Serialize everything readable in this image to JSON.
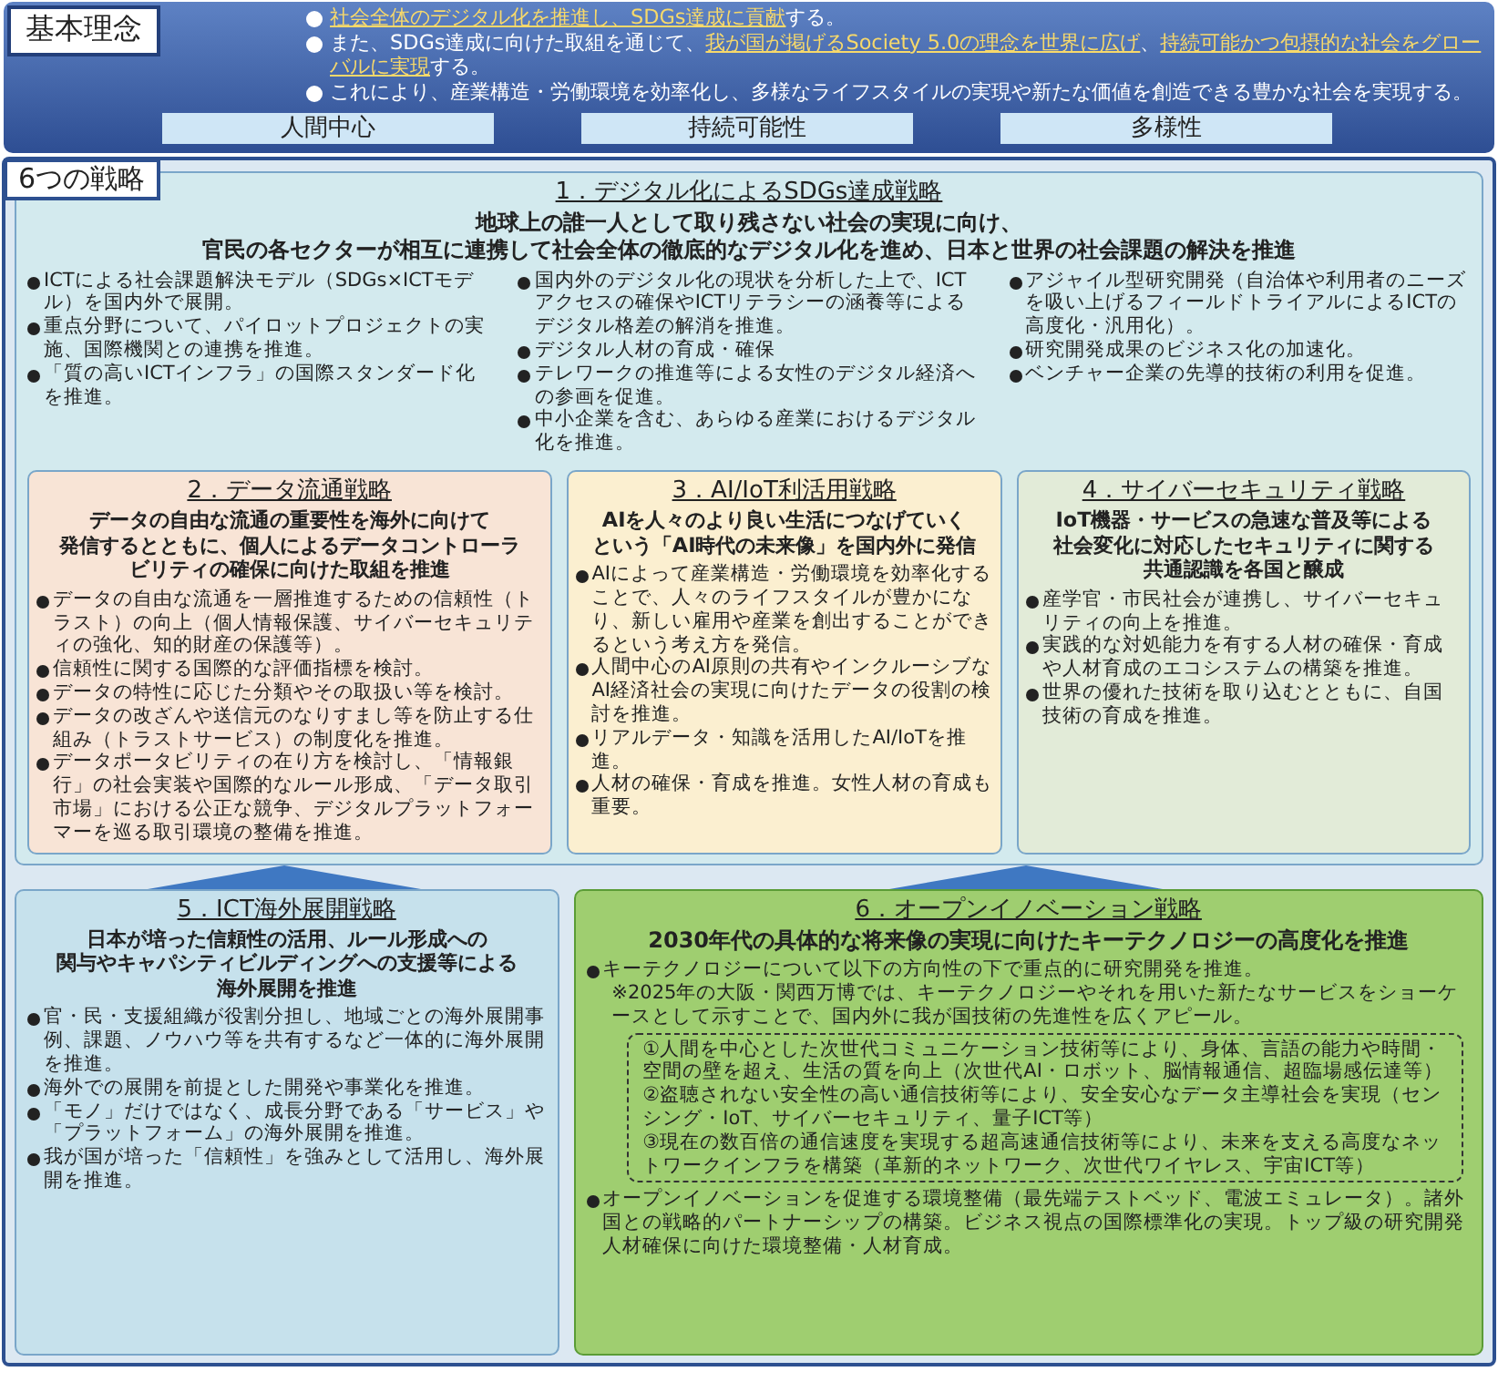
{
  "basic_philosophy": {
    "label": "基本理念",
    "bullets": [
      [
        {
          "text": "社会全体のデジタル化を推進し、SDGs達成に貢献",
          "highlight": true
        },
        {
          "text": "する。",
          "highlight": false
        }
      ],
      [
        {
          "text": "また、SDGs達成に向けた取組を通じて、",
          "highlight": false
        },
        {
          "text": "我が国が掲げるSociety 5.0の理念を世界に広げ",
          "highlight": true
        },
        {
          "text": "、",
          "highlight": false
        },
        {
          "text": "持続可能かつ包摂的な社会をグローバルに実現",
          "highlight": true
        },
        {
          "text": "する。",
          "highlight": false
        }
      ],
      [
        {
          "text": "これにより、産業構造・労働環境を効率化し、多様なライフスタイルの実現や新たな価値を創造できる豊かな社会を実現する。",
          "highlight": false
        }
      ]
    ],
    "pillars": [
      "人間中心",
      "持続可能性",
      "多様性"
    ]
  },
  "strategies": {
    "label": "6つの戦略",
    "items": [
      {
        "title": "1．デジタル化によるSDGs達成戦略",
        "color": "#d3eaee",
        "summary": [
          "地球上の誰一人として取り残さない社会の実現に向け、",
          "官民の各セクターが相互に連携して社会全体の徹底的なデジタル化を進め、日本と世界の社会課題の解決を推進"
        ],
        "columns": [
          [
            "ICTによる社会課題解決モデル（SDGs×ICTモデル）を国内外で展開。",
            "重点分野について、パイロットプロジェクトの実施、国際機関との連携を推進。",
            "「質の高いICTインフラ」の国際スタンダード化を推進。"
          ],
          [
            "国内外のデジタル化の現状を分析した上で、ICTアクセスの確保やICTリテラシーの涵養等によるデジタル格差の解消を推進。",
            "デジタル人材の育成・確保",
            "テレワークの推進等による女性のデジタル経済への参画を促進。",
            "中小企業を含む、あらゆる産業におけるデジタル化を推進。"
          ],
          [
            "アジャイル型研究開発（自治体や利用者のニーズを吸い上げるフィールドトライアルによるICTの高度化・汎用化）。",
            "研究開発成果のビジネス化の加速化。",
            "ベンチャー企業の先導的技術の利用を促進。"
          ]
        ],
        "children": [
          {
            "title": "2．データ流通戦略",
            "color": "#f8e4d6",
            "summary": [
              "データの自由な流通の重要性を海外に向けて",
              "発信するとともに、個人によるデータコントローラ",
              "ビリティの確保に向けた取組を推進"
            ],
            "blocks": [
              {
                "kind": "bullet",
                "text": "データの自由な流通を一層推進するための信頼性（トラスト）の向上（個人情報保護、サイバーセキュリティの強化、知的財産の保護等）。"
              },
              {
                "kind": "bullet",
                "text": "信頼性に関する国際的な評価指標を検討。"
              },
              {
                "kind": "bullet",
                "text": "データの特性に応じた分類やその取扱い等を検討。"
              },
              {
                "kind": "bullet",
                "text": "データの改ざんや送信元のなりすまし等を防止する仕組み（トラストサービス）の制度化を推進。"
              },
              {
                "kind": "bullet",
                "text": "データポータビリティの在り方を検討し、「情報銀行」の社会実装や国際的なルール形成、「データ取引市場」における公正な競争、デジタルプラットフォーマーを巡る取引環境の整備を推進。"
              }
            ]
          },
          {
            "title": "3．AI/IoT利活用戦略",
            "color": "#fbefd0",
            "summary": [
              "AIを人々のより良い生活につなげていく",
              "という「AI時代の未来像」を国内外に発信"
            ],
            "blocks": [
              {
                "kind": "bullet",
                "text": "AIによって産業構造・労働環境を効率化することで、人々のライフスタイルが豊かになり、新しい雇用や産業を創出することができるという考え方を発信。"
              },
              {
                "kind": "bullet",
                "text": "人間中心のAI原則の共有やインクルーシブなAI経済社会の実現に向けたデータの役割の検討を推進。"
              },
              {
                "kind": "bullet",
                "text": "リアルデータ・知識を活用したAI/IoTを推進。"
              },
              {
                "kind": "bullet",
                "text": "人材の確保・育成を推進。女性人材の育成も重要。"
              }
            ]
          },
          {
            "title": "4．サイバーセキュリティ戦略",
            "color": "#e2ebd8",
            "summary": [
              "IoT機器・サービスの急速な普及等による",
              "社会変化に対応したセキュリティに関する",
              "共通認識を各国と醸成"
            ],
            "blocks": [
              {
                "kind": "bullet",
                "text": "産学官・市民社会が連携し、サイバーセキュリティの向上を推進。"
              },
              {
                "kind": "bullet",
                "text": "実践的な対処能力を有する人材の確保・育成や人材育成のエコシステムの構築を推進。"
              },
              {
                "kind": "bullet",
                "text": "世界の優れた技術を取り込むとともに、自国技術の育成を推進。"
              }
            ]
          }
        ]
      },
      {
        "title": "5．ICT海外展開戦略",
        "color": "#c6e1ec",
        "summary": [
          "日本が培った信頼性の活用、ルール形成への",
          "関与やキャパシティビルディングへの支援等による",
          "海外展開を推進"
        ],
        "blocks": [
          {
            "kind": "bullet",
            "text": "官・民・支援組織が役割分担し、地域ごとの海外展開事例、課題、ノウハウ等を共有するなど一体的に海外展開を推進。"
          },
          {
            "kind": "bullet",
            "text": "海外での展開を前提とした開発や事業化を推進。"
          },
          {
            "kind": "bullet",
            "text": "「モノ」だけではなく、成長分野である「サービス」や「プラットフォーム」の海外展開を推進。"
          },
          {
            "kind": "bullet",
            "text": "我が国が培った「信頼性」を強みとして活用し、海外展開を推進。"
          }
        ]
      },
      {
        "title": "6．オープンイノベーション戦略",
        "color": "#9fce70",
        "summary": [
          "2030年代の具体的な将来像の実現に向けたキーテクノロジーの高度化を推進"
        ],
        "blocks": [
          {
            "kind": "bullet",
            "text": "キーテクノロジーについて以下の方向性の下で重点的に研究開発を推進。"
          },
          {
            "kind": "note",
            "text": "※2025年の大阪・関西万博では、キーテクノロジーやそれを用いた新たなサービスをショーケースとして示すことで、国内外に我が国技術の先進性を広くアピール。"
          },
          {
            "kind": "box",
            "items": [
              "①人間を中心とした次世代コミュニケーション技術等により、身体、言語の能力や時間・空間の壁を超え、生活の質を向上（次世代AI・ロボット、脳情報通信、超臨場感伝達等）",
              "②盗聴されない安全性の高い通信技術等により、安全安心なデータ主導社会を実現（センシング・IoT、サイバーセキュリティ、量子ICT等）",
              "③現在の数百倍の通信速度を実現する超高速通信技術等により、未来を支える高度なネットワークインフラを構築（革新的ネットワーク、次世代ワイヤレス、宇宙ICT等）"
            ]
          },
          {
            "kind": "bullet",
            "text": "オープンイノベーションを促進する環境整備（最先端テストベッド、電波エミュレータ）。諸外国との戦略的パートナーシップの構築。ビジネス視点の国際標準化の実現。トップ級の研究開発人材確保に向けた環境整備・人材育成。"
          }
        ]
      }
    ]
  }
}
